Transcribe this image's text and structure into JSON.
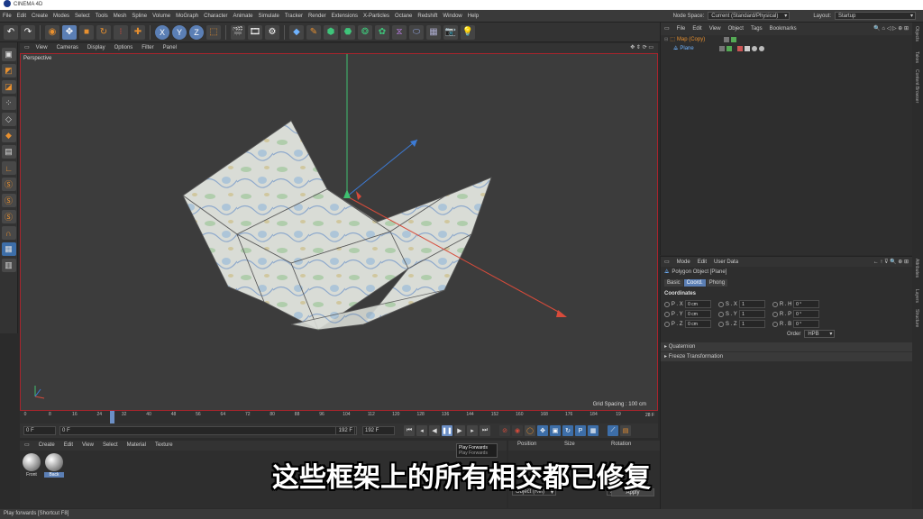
{
  "app": {
    "title": "CINEMA 4D"
  },
  "menu": [
    "File",
    "Edit",
    "Create",
    "Modes",
    "Select",
    "Tools",
    "Mesh",
    "Spline",
    "Volume",
    "MoGraph",
    "Character",
    "Animate",
    "Simulate",
    "Tracker",
    "Render",
    "Extensions",
    "X-Particles",
    "Octane",
    "Redshift",
    "Window",
    "Help"
  ],
  "node_space": {
    "label": "Node Space:",
    "value": "Current (Standard/Physical)"
  },
  "layout": {
    "label": "Layout:",
    "value": "Startup"
  },
  "toolbar": {
    "axis_x": "X",
    "axis_y": "Y",
    "axis_z": "Z"
  },
  "viewport": {
    "menu": [
      "View",
      "Cameras",
      "Display",
      "Options",
      "Filter",
      "Panel"
    ],
    "label": "Perspective",
    "grid_spacing": "Grid Spacing : 100 cm"
  },
  "timeline": {
    "ticks": [
      "0",
      "8",
      "16",
      "24",
      "32",
      "40",
      "48",
      "56",
      "64",
      "72",
      "80",
      "88",
      "96",
      "104",
      "112",
      "120",
      "128",
      "136",
      "144",
      "152",
      "160",
      "168",
      "176",
      "184",
      "19"
    ],
    "current_frame_display": "28 F",
    "playhead_frame": 28,
    "max_frame": 192
  },
  "transport": {
    "start": "0 F",
    "min": "0 F",
    "max": "192 F",
    "end": "192 F"
  },
  "materials": {
    "menu": [
      "Create",
      "Edit",
      "View",
      "Select",
      "Material",
      "Texture"
    ],
    "items": [
      {
        "label": "Front"
      },
      {
        "label": "Back"
      }
    ]
  },
  "coordinates": {
    "headers": {
      "position": "Position",
      "size": "Size",
      "rotation": "Rotation"
    },
    "mode": "Object (Rel)",
    "size_mode": "Size",
    "apply": "Apply"
  },
  "tooltip": {
    "title": "Play Forwards",
    "shortcut": "Play Forwards"
  },
  "status": "Play forwards [Shortcut F8]",
  "objects": {
    "menu": [
      "File",
      "Edit",
      "View",
      "Object",
      "Tags",
      "Bookmarks"
    ],
    "rows": [
      {
        "name": "Map (Copy)",
        "color": "#e8902f"
      },
      {
        "name": "Plane",
        "color": "#6fb3ff"
      }
    ]
  },
  "attributes": {
    "menu": [
      "Mode",
      "Edit",
      "User Data"
    ],
    "object_title": "Polygon Object [Plane]",
    "tabs": [
      "Basic",
      "Coord.",
      "Phong"
    ],
    "active_tab": "Coord.",
    "section": "Coordinates",
    "rows": [
      [
        {
          "label": "P . X",
          "value": "0 cm"
        },
        {
          "label": "S . X",
          "value": "1"
        },
        {
          "label": "R . H",
          "value": "0 °"
        }
      ],
      [
        {
          "label": "P . Y",
          "value": "0 cm"
        },
        {
          "label": "S . Y",
          "value": "1"
        },
        {
          "label": "R . P",
          "value": "0 °"
        }
      ],
      [
        {
          "label": "P . Z",
          "value": "0 cm"
        },
        {
          "label": "S . Z",
          "value": "1"
        },
        {
          "label": "R . B",
          "value": "0 °"
        }
      ]
    ],
    "order_label": "Order",
    "order_value": "HPB",
    "collapsed": [
      "Quaternion",
      "Freeze Transformation"
    ]
  },
  "side_tabs": [
    "Objects",
    "Takes",
    "Content Browser",
    "Attributes",
    "Layers",
    "Structure"
  ],
  "subtitle": "这些框架上的所有相交都已修复",
  "colors": {
    "accent": "#5b7fb5",
    "viewport_border": "#a8242c",
    "orange": "#e8902f"
  }
}
